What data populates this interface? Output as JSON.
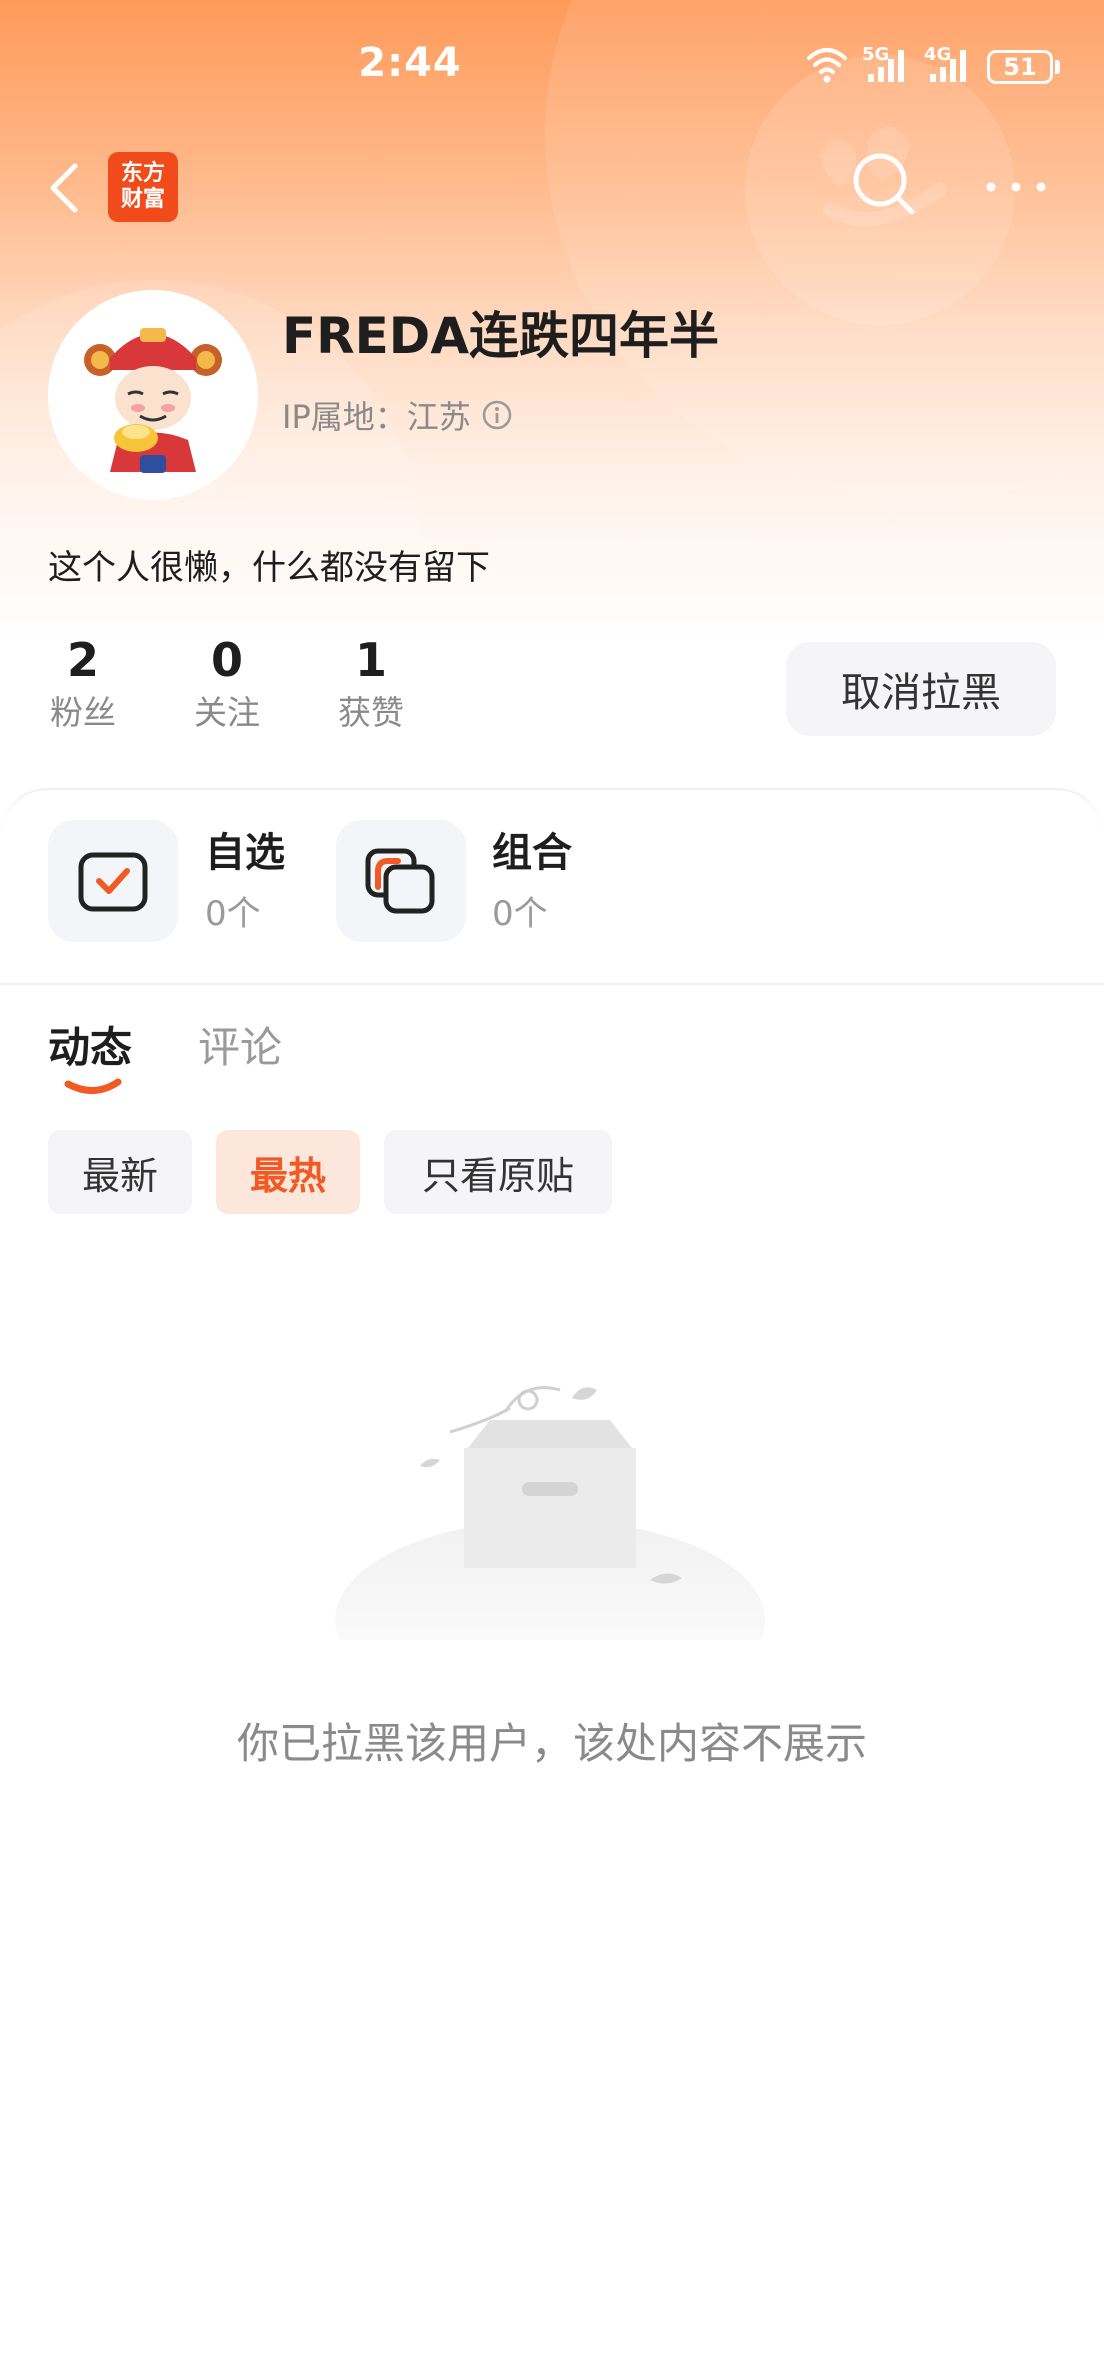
{
  "status_bar": {
    "time": "2:44",
    "network_1": "5G",
    "network_2": "4G",
    "battery": "51"
  },
  "nav": {
    "logo_line1": "东方",
    "logo_line2": "财富"
  },
  "profile": {
    "username": "FREDA连跌四年半",
    "ip_location": "IP属地：江苏",
    "bio": "这个人很懒，什么都没有留下"
  },
  "stats": [
    {
      "value": "2",
      "label": "粉丝"
    },
    {
      "value": "0",
      "label": "关注"
    },
    {
      "value": "1",
      "label": "获赞"
    }
  ],
  "unblock_button": "取消拉黑",
  "shortcuts": [
    {
      "title": "自选",
      "count": "0个",
      "icon": "checkbox-icon"
    },
    {
      "title": "组合",
      "count": "0个",
      "icon": "portfolio-icon"
    }
  ],
  "tabs": [
    {
      "label": "动态",
      "active": true
    },
    {
      "label": "评论",
      "active": false
    }
  ],
  "filters": [
    {
      "label": "最新",
      "active": false
    },
    {
      "label": "最热",
      "active": true
    },
    {
      "label": "只看原贴",
      "active": false
    }
  ],
  "empty_state": {
    "message": "你已拉黑该用户，该处内容不展示"
  },
  "colors": {
    "accent": "#f15a24",
    "header_gradient_top": "#ff9a5a",
    "chip_active_bg": "#fde6dc",
    "logo_bg": "#f14b1c"
  }
}
